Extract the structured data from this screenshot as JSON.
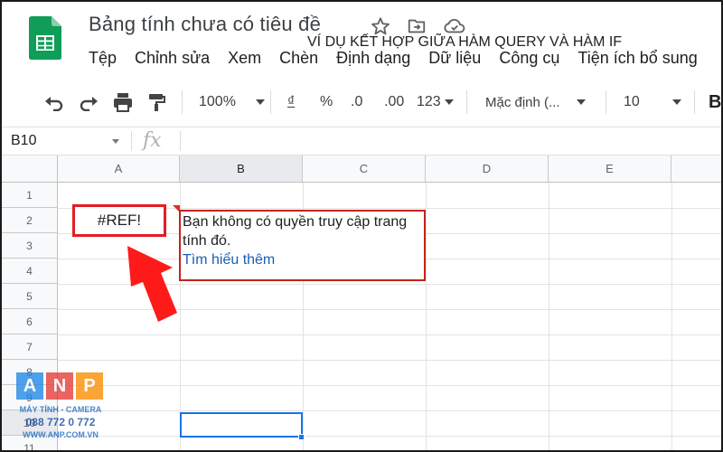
{
  "header": {
    "title": "Bảng tính chưa có tiêu đề"
  },
  "menu": {
    "items": [
      "Tệp",
      "Chỉnh sửa",
      "Xem",
      "Chèn",
      "Định dạng",
      "Dữ liệu",
      "Công cụ",
      "Tiện ích bổ sung"
    ]
  },
  "toolbar": {
    "zoom": "100%",
    "currency": "₫",
    "percent": "%",
    "decrease_decimals": ".0",
    "increase_decimals": ".00",
    "more_formats": "123",
    "font": "Mặc định (...",
    "font_size": "10",
    "bold": "B"
  },
  "formula_bar": {
    "name_box": "B10",
    "fx": "fx"
  },
  "grid": {
    "columns": [
      "A",
      "B",
      "C",
      "D",
      "E"
    ],
    "rows": [
      "1",
      "2",
      "3",
      "4",
      "5",
      "6",
      "7",
      "8",
      "9",
      "10",
      "11"
    ]
  },
  "cells": {
    "C1": "VÍ DỤ KẾT HỢP GIỮA HÀM QUERY VÀ HÀM IF",
    "A2": "#REF!"
  },
  "tooltip": {
    "message": "Bạn không có quyền truy cập trang tính đó.",
    "link": "Tìm hiểu thêm"
  },
  "watermark": {
    "letters": [
      "A",
      "N",
      "P"
    ],
    "line1": "MÁY TÍNH - CAMERA",
    "phone": "088 772 0 772",
    "site": "WWW.ANP.COM.VN"
  },
  "colors": {
    "accent_red": "#e51c23",
    "selection_blue": "#1a73e8",
    "link_blue": "#1a5fb4",
    "sheets_green": "#0f9d58"
  }
}
